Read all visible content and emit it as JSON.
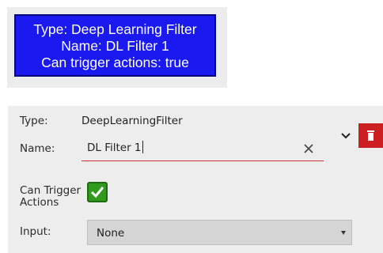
{
  "tooltip": {
    "line1": "Type: Deep Learning Filter",
    "line2": "Name: DL Filter 1",
    "line3": "Can trigger actions: true"
  },
  "form": {
    "type_label": "Type:",
    "type_value": "DeepLearningFilter",
    "name_label": "Name:",
    "name_value": "DL Filter 1",
    "trigger_label_line1": "Can Trigger",
    "trigger_label_line2": "Actions",
    "trigger_checked": true,
    "input_label": "Input:",
    "input_value": "None"
  },
  "colors": {
    "tooltip_bg": "#1919f0",
    "delete_button": "#cc1f1f",
    "checkbox": "#2f9a1c",
    "input_underline": "#c8323a"
  },
  "icons": {
    "clear": "close-icon",
    "collapse": "chevron-down-icon",
    "delete": "trash-icon",
    "check": "check-icon",
    "dropdown": "dropdown-arrow-icon"
  }
}
